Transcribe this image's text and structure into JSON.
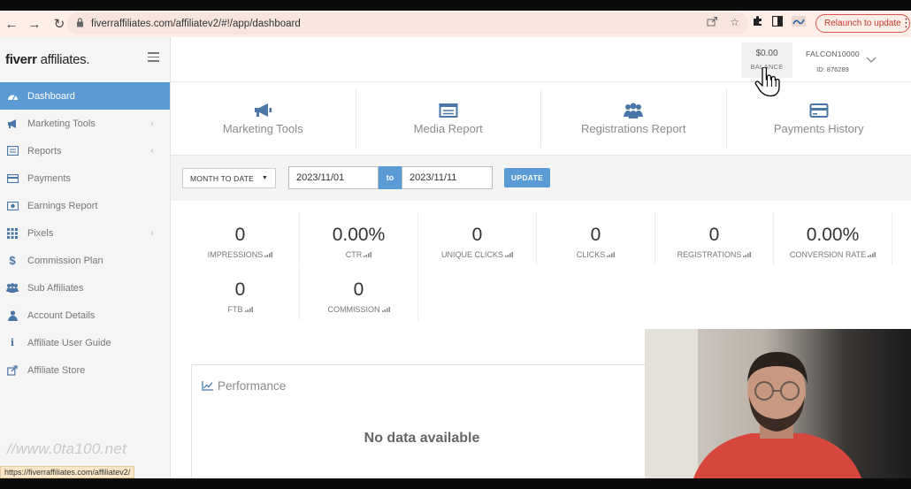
{
  "browser": {
    "url": "fiverraffiliates.com/affiliatev2/#!/app/dashboard",
    "relaunch_label": "Relaunch to update",
    "status_url": "https://fiverraffiliates.com/affiliatev2/"
  },
  "brand": {
    "logo_bold": "fiverr",
    "logo_rest": " affiliates.",
    "accent": "#5b9bd5"
  },
  "sidebar": {
    "items": [
      {
        "label": "Dashboard",
        "icon": "dashboard-icon"
      },
      {
        "label": "Marketing Tools",
        "icon": "megaphone-icon"
      },
      {
        "label": "Reports",
        "icon": "report-icon"
      },
      {
        "label": "Payments",
        "icon": "credit-card-icon"
      },
      {
        "label": "Earnings Report",
        "icon": "money-icon"
      },
      {
        "label": "Pixels",
        "icon": "grid-icon"
      },
      {
        "label": "Commission Plan",
        "icon": "dollar-icon"
      },
      {
        "label": "Sub Affiliates",
        "icon": "users-icon"
      },
      {
        "label": "Account Details",
        "icon": "user-icon"
      },
      {
        "label": "Affiliate User Guide",
        "icon": "info-icon"
      },
      {
        "label": "Affiliate Store",
        "icon": "external-link-icon"
      }
    ],
    "watermark": "//www.0ta100.net"
  },
  "header": {
    "balance_amount": "$0.00",
    "balance_label": "BALANCE",
    "username": "FALCON10000",
    "user_id": "ID: 876289"
  },
  "tiles": [
    {
      "label": "Marketing Tools",
      "icon": "megaphone-icon"
    },
    {
      "label": "Media Report",
      "icon": "report-icon"
    },
    {
      "label": "Registrations Report",
      "icon": "users-icon"
    },
    {
      "label": "Payments History",
      "icon": "credit-card-icon"
    }
  ],
  "filter": {
    "range_label": "MONTH TO DATE",
    "from_date": "2023/11/01",
    "to_label": "to",
    "to_date": "2023/11/11",
    "update_label": "UPDATE"
  },
  "stats": [
    {
      "value": "0",
      "label": "IMPRESSIONS"
    },
    {
      "value": "0.00%",
      "label": "CTR"
    },
    {
      "value": "0",
      "label": "UNIQUE CLICKS"
    },
    {
      "value": "0",
      "label": "CLICKS"
    },
    {
      "value": "0",
      "label": "REGISTRATIONS"
    },
    {
      "value": "0.00%",
      "label": "CONVERSION RATE"
    },
    {
      "value": "0",
      "label": "FTB"
    },
    {
      "value": "0",
      "label": "COMMISSION"
    }
  ],
  "performance": {
    "title": "Performance",
    "empty_text": "No data available"
  }
}
